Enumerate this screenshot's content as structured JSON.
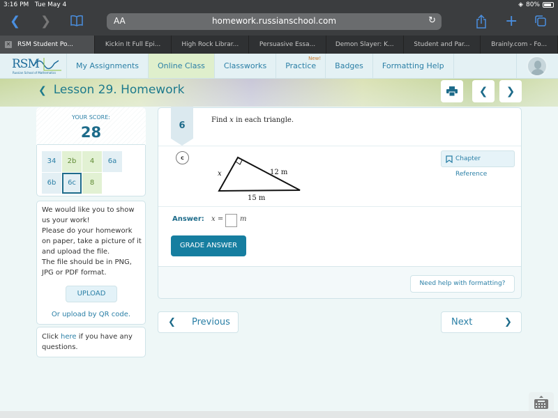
{
  "status_bar": {
    "time": "3:16 PM",
    "date": "Tue May 4",
    "battery": "80%"
  },
  "browser": {
    "url": "homework.russianschool.com",
    "text_size_label": "AA",
    "tabs": [
      {
        "label": "RSM Student Po...",
        "active": true
      },
      {
        "label": "Kickin It Full Epi...",
        "active": false
      },
      {
        "label": "High Rock Librar...",
        "active": false
      },
      {
        "label": "Persuasive Essa...",
        "active": false
      },
      {
        "label": "Demon Slayer: K...",
        "active": false
      },
      {
        "label": "Student and Par...",
        "active": false
      },
      {
        "label": "Brainly.com - Fo...",
        "active": false
      }
    ]
  },
  "logo": {
    "text": "RSM",
    "subtitle": "Russian School of Mathematics"
  },
  "nav": {
    "items": [
      {
        "label": "My Assignments",
        "active": false
      },
      {
        "label": "Online Class",
        "active": true
      },
      {
        "label": "Classworks",
        "active": false
      },
      {
        "label": "Practice",
        "active": false,
        "badge": "New!"
      },
      {
        "label": "Badges",
        "active": false
      },
      {
        "label": "Formatting Help",
        "active": false
      }
    ]
  },
  "page": {
    "title": "Lesson 29. Homework"
  },
  "score": {
    "label": "YOUR SCORE:",
    "value": "28",
    "questions": [
      {
        "label": "34",
        "status": "blue"
      },
      {
        "label": "2b",
        "status": "green"
      },
      {
        "label": "4",
        "status": "green"
      },
      {
        "label": "6a",
        "status": "blue"
      },
      {
        "label": "6b",
        "status": "blue"
      },
      {
        "label": "6c",
        "status": "blue",
        "current": true
      },
      {
        "label": "8",
        "status": "green"
      }
    ]
  },
  "upload_panel": {
    "lines": [
      "We would like you to show",
      "us your work!",
      "Please do your homework",
      "on paper, take a picture of it",
      "and upload the file.",
      "The file should be in PNG,",
      "JPG or PDF format."
    ],
    "upload_label": "UPLOAD",
    "qr_label": "Or upload by QR code."
  },
  "help_panel": {
    "prefix": "Click ",
    "link": "here",
    "suffix": " if you have any",
    "line2": "questions."
  },
  "question": {
    "number": "6",
    "prompt_prefix": "Find ",
    "prompt_var": "x",
    "prompt_suffix": " in each triangle.",
    "part": "c",
    "chapter_reference": "Chapter Reference",
    "figure": {
      "side_x": "x",
      "side_a": "12 m",
      "side_b": "15 m"
    },
    "answer_label": "Answer:",
    "answer_prefix": "x =",
    "answer_value": "",
    "answer_unit": "m",
    "grade_label": "GRADE ANSWER",
    "help_label": "Need help with formatting?"
  },
  "pager": {
    "previous": "Previous",
    "next": "Next"
  }
}
